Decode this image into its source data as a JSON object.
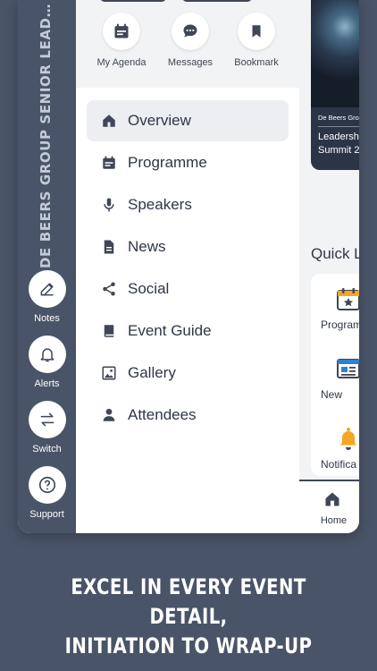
{
  "rail": {
    "event_title": "DE BEERS GROUP SENIOR LEADERSHIP C...",
    "buttons": [
      {
        "label": "Notes",
        "icon": "pencil-icon"
      },
      {
        "label": "Alerts",
        "icon": "bell-icon"
      },
      {
        "label": "Switch",
        "icon": "swap-icon"
      },
      {
        "label": "Support",
        "icon": "help-circle-icon"
      }
    ]
  },
  "quick_actions": [
    {
      "label": "My Agenda",
      "icon": "calendar-icon"
    },
    {
      "label": "Messages",
      "icon": "chat-bubble-icon"
    },
    {
      "label": "Bookmark",
      "icon": "bookmark-icon"
    }
  ],
  "nav": {
    "items": [
      {
        "label": "Overview",
        "icon": "home-icon",
        "active": true
      },
      {
        "label": "Programme",
        "icon": "calendar-icon"
      },
      {
        "label": "Speakers",
        "icon": "microphone-icon"
      },
      {
        "label": "News",
        "icon": "document-icon"
      },
      {
        "label": "Social",
        "icon": "share-icon"
      },
      {
        "label": "Event Guide",
        "icon": "book-icon"
      },
      {
        "label": "Gallery",
        "icon": "image-icon"
      },
      {
        "label": "Attendees",
        "icon": "person-icon"
      }
    ]
  },
  "background_page": {
    "banner": {
      "org": "De Beers Gro",
      "title_line1": "Leadershi",
      "title_line2": "Summit 2"
    },
    "quick_links_heading": "Quick L",
    "quick_links": [
      {
        "label": "Program",
        "icon": "calendar-star-icon"
      },
      {
        "label": "New",
        "icon": "newspaper-icon"
      },
      {
        "label": "Notifica",
        "icon": "bell-icon"
      }
    ],
    "tab": {
      "label": "Home",
      "icon": "home-icon"
    }
  },
  "caption": {
    "line1": "EXCEL IN EVERY EVENT DETAIL,",
    "line2": "INITIATION TO WRAP-UP"
  },
  "colors": {
    "background": "#4a5468",
    "text_dark": "#2f3645",
    "accent_orange": "#f5a623",
    "accent_blue": "#2f7fd3"
  }
}
